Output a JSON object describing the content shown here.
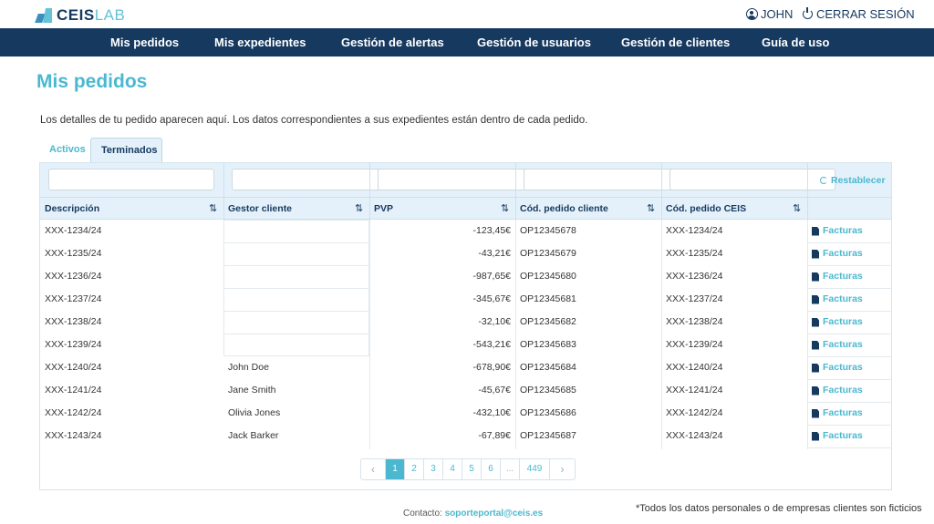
{
  "header": {
    "logo_primary": "CEIS",
    "logo_secondary": "LAB",
    "user_name": "JOHN",
    "logout_label": "CERRAR SESIÓN"
  },
  "nav": {
    "items": [
      {
        "label": "Mis pedidos"
      },
      {
        "label": "Mis expedientes"
      },
      {
        "label": "Gestión de alertas"
      },
      {
        "label": "Gestión de usuarios"
      },
      {
        "label": "Gestión de clientes"
      },
      {
        "label": "Guía de uso"
      }
    ]
  },
  "page": {
    "title": "Mis pedidos",
    "intro": "Los detalles de tu pedido aparecen aquí. Los datos correspondientes a sus expedientes están dentro de cada pedido."
  },
  "tabs": [
    {
      "label": "Activos",
      "active": false
    },
    {
      "label": "Terminados",
      "active": true
    }
  ],
  "table": {
    "reset_label": "Restablecer",
    "columns": [
      "Descripción",
      "Gestor cliente",
      "PVP",
      "Cód. pedido cliente",
      "Cód. pedido CEIS"
    ],
    "invoice_label": "Facturas",
    "rows": [
      {
        "desc": "XXX-1234/24",
        "gestor": "",
        "pvp": "-123,45€",
        "cod_cliente": "OP12345678",
        "cod_ceis": "XXX-1234/24"
      },
      {
        "desc": "XXX-1235/24",
        "gestor": "",
        "pvp": "-43,21€",
        "cod_cliente": "OP12345679",
        "cod_ceis": "XXX-1235/24"
      },
      {
        "desc": "XXX-1236/24",
        "gestor": "",
        "pvp": "-987,65€",
        "cod_cliente": "OP12345680",
        "cod_ceis": "XXX-1236/24"
      },
      {
        "desc": "XXX-1237/24",
        "gestor": "",
        "pvp": "-345,67€",
        "cod_cliente": "OP12345681",
        "cod_ceis": "XXX-1237/24"
      },
      {
        "desc": "XXX-1238/24",
        "gestor": "",
        "pvp": "-32,10€",
        "cod_cliente": "OP12345682",
        "cod_ceis": "XXX-1238/24"
      },
      {
        "desc": "XXX-1239/24",
        "gestor": "",
        "pvp": "-543,21€",
        "cod_cliente": "OP12345683",
        "cod_ceis": "XXX-1239/24"
      },
      {
        "desc": "XXX-1240/24",
        "gestor": "John Doe",
        "pvp": "-678,90€",
        "cod_cliente": "OP12345684",
        "cod_ceis": "XXX-1240/24"
      },
      {
        "desc": "XXX-1241/24",
        "gestor": "Jane Smith",
        "pvp": "-45,67€",
        "cod_cliente": "OP12345685",
        "cod_ceis": "XXX-1241/24"
      },
      {
        "desc": "XXX-1242/24",
        "gestor": "Olivia Jones",
        "pvp": "-432,10€",
        "cod_cliente": "OP12345686",
        "cod_ceis": "XXX-1242/24"
      },
      {
        "desc": "XXX-1243/24",
        "gestor": "Jack Barker",
        "pvp": "-67,89€",
        "cod_cliente": "OP12345687",
        "cod_ceis": "XXX-1243/24"
      }
    ]
  },
  "pagination": {
    "prev": "‹",
    "next": "›",
    "pages": [
      "1",
      "2",
      "3",
      "4",
      "5",
      "6",
      "...",
      "449"
    ],
    "current": "1"
  },
  "footer": {
    "contact_label": "Contacto:",
    "contact_email": "soporteportal@ceis.es",
    "disclaimer": "*Todos los datos personales o de empresas clientes son ficticios"
  },
  "colors": {
    "navy": "#16395f",
    "accent": "#4bb8d0",
    "table_header_bg": "#e4f1fa"
  }
}
